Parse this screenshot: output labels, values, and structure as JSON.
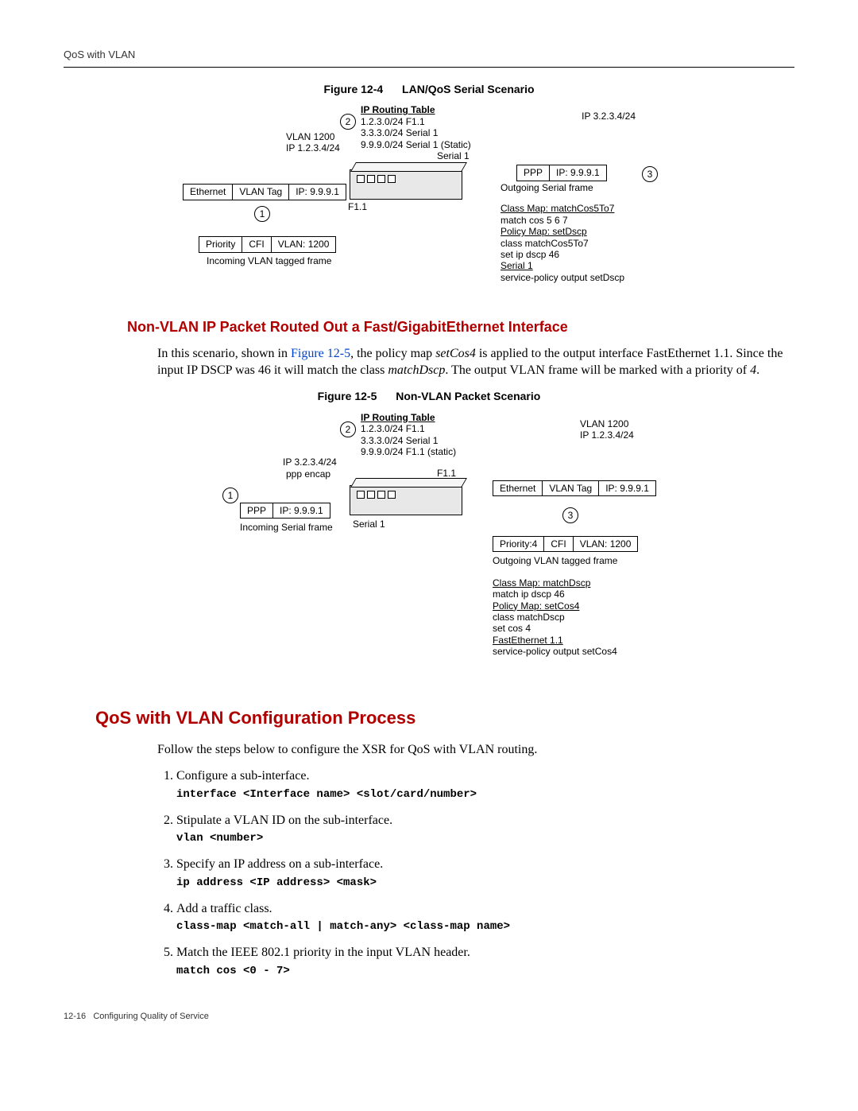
{
  "header": {
    "running_title": "QoS with VLAN"
  },
  "figure1": {
    "label": "Figure 12-4",
    "title": "LAN/QoS Serial Scenario",
    "routing_table_heading": "IP Routing Table",
    "routing_table": [
      "1.2.3.0/24 F1.1",
      "3.3.3.0/24 Serial 1",
      "9.9.9.0/24 Serial 1 (Static)"
    ],
    "step_1": "1",
    "step_2": "2",
    "step_3": "3",
    "vlan_top": "VLAN 1200",
    "ip_top": "IP 1.2.3.4/24",
    "right_ip": "IP 3.2.3.4/24",
    "serial_label": "Serial 1",
    "f11_label": "F1.1",
    "eth_cells": {
      "c1": "Ethernet",
      "c2": "VLAN Tag",
      "c3": "IP: 9.9.9.1"
    },
    "pri_cells": {
      "c1": "Priority",
      "c2": "CFI",
      "c3": "VLAN: 1200"
    },
    "ppp_cells": {
      "c1": "PPP",
      "c2": "IP: 9.9.9.1"
    },
    "left_caption": "Incoming VLAN tagged frame",
    "right_caption": "Outgoing Serial frame",
    "class_map_heading": "Class Map: matchCos5To7",
    "class_map_line": "match cos 5 6 7",
    "policy_map_heading": "Policy Map: setDscp",
    "policy_map_line1": "class matchCos5To7",
    "policy_map_line2": "set ip dscp 46",
    "serial_heading": "Serial 1",
    "serial_line": "service-policy output setDscp"
  },
  "section1": {
    "heading": "Non-VLAN IP Packet Routed Out a Fast/GigabitEthernet Interface",
    "para_pre": "In this scenario, shown in ",
    "figref": "Figure 12-5",
    "para_mid1": ", the policy map ",
    "em1": "setCos4",
    "para_mid2": " is applied to the output interface FastEthernet 1.1. Since the input IP DSCP was 46 it will match the class ",
    "em2": "matchDscp",
    "para_mid3": ". The output VLAN frame will be marked with a priority of ",
    "em3": "4",
    "para_end": "."
  },
  "figure2": {
    "label": "Figure 12-5",
    "title": "Non-VLAN Packet Scenario",
    "routing_table_heading": "IP Routing Table",
    "routing_table": [
      "1.2.3.0/24 F1.1",
      "3.3.3.0/24 Serial 1",
      "9.9.9.0/24 F1.1 (static)"
    ],
    "step_1": "1",
    "step_2": "2",
    "step_3": "3",
    "left_ip": "IP 3.2.3.4/24",
    "left_encap": "ppp encap",
    "vlan_top": "VLAN 1200",
    "ip_top": "IP 1.2.3.4/24",
    "f11_label": "F1.1",
    "serial_label": "Serial 1",
    "ppp_cells": {
      "c1": "PPP",
      "c2": "IP: 9.9.9.1"
    },
    "left_caption": "Incoming Serial frame",
    "eth_cells": {
      "c1": "Ethernet",
      "c2": "VLAN Tag",
      "c3": "IP: 9.9.9.1"
    },
    "pri_cells": {
      "c1": "Priority:4",
      "c2": "CFI",
      "c3": "VLAN: 1200"
    },
    "right_caption": "Outgoing VLAN tagged frame",
    "class_map_heading": "Class Map: matchDscp",
    "class_map_line": "match ip dscp 46",
    "policy_map_heading": "Policy Map: setCos4",
    "policy_map_line1": "class matchDscp",
    "policy_map_line2": "set cos 4",
    "fe_heading": "FastEthernet 1.1",
    "fe_line": "service-policy output setCos4"
  },
  "section2": {
    "heading": "QoS with VLAN Configuration Process",
    "intro": "Follow the steps below to configure the XSR for QoS with VLAN routing."
  },
  "steps": [
    {
      "text": "Configure a sub-interface.",
      "code": "interface <Interface name> <slot/card/number>"
    },
    {
      "text": "Stipulate a VLAN ID on the sub-interface.",
      "code": "vlan <number>"
    },
    {
      "text": "Specify an IP address on a sub-interface.",
      "code": "ip address <IP address> <mask>"
    },
    {
      "text": "Add a traffic class.",
      "code": "class-map <match-all | match-any> <class-map name>"
    },
    {
      "text": "Match the IEEE 802.1 priority in the input VLAN header.",
      "code": "match cos <0 - 7>"
    }
  ],
  "footer": {
    "page": "12-16",
    "title": "Configuring Quality of Service"
  }
}
